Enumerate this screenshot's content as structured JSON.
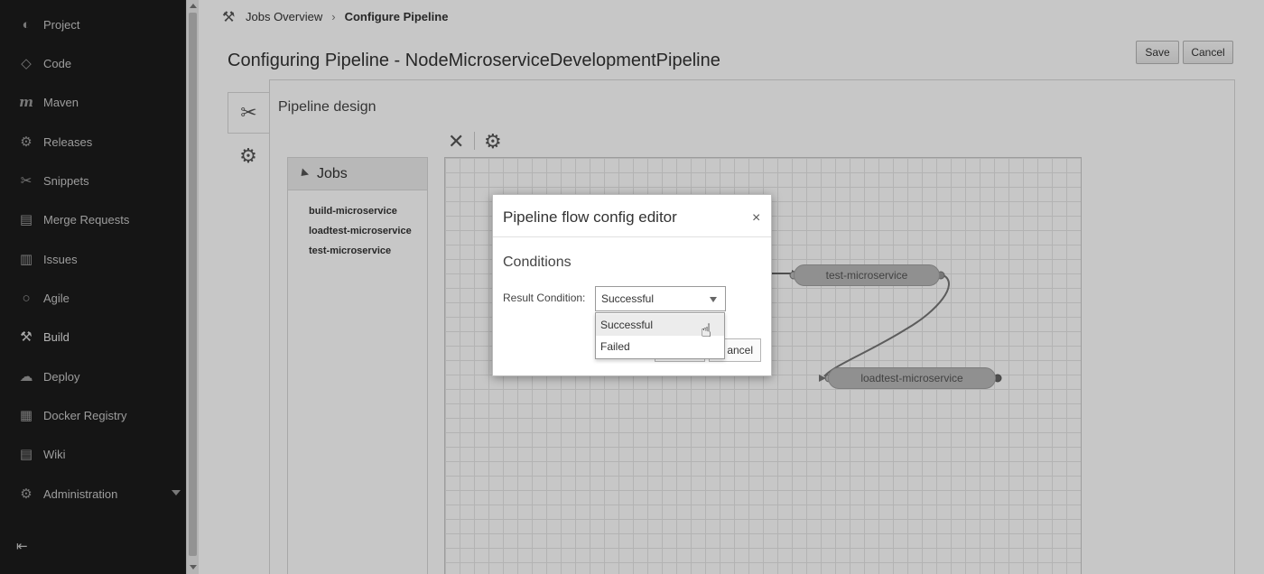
{
  "sidebar": {
    "items": [
      {
        "label": "Project",
        "icon": "globe-icon",
        "glyph": "◐"
      },
      {
        "label": "Code",
        "icon": "code-icon",
        "glyph": "◇"
      },
      {
        "label": "Maven",
        "icon": "maven-icon",
        "glyph": "m"
      },
      {
        "label": "Releases",
        "icon": "gear-icon",
        "glyph": "⚙"
      },
      {
        "label": "Snippets",
        "icon": "scissors-icon",
        "glyph": "✂"
      },
      {
        "label": "Merge Requests",
        "icon": "merge-icon",
        "glyph": "▤"
      },
      {
        "label": "Issues",
        "icon": "issues-icon",
        "glyph": "▥"
      },
      {
        "label": "Agile",
        "icon": "agile-icon",
        "glyph": "○"
      },
      {
        "label": "Build",
        "icon": "hammer-icon",
        "glyph": "⚒"
      },
      {
        "label": "Deploy",
        "icon": "cloud-icon",
        "glyph": "☁"
      },
      {
        "label": "Docker Registry",
        "icon": "docker-icon",
        "glyph": "▦"
      },
      {
        "label": "Wiki",
        "icon": "wiki-icon",
        "glyph": "▤"
      },
      {
        "label": "Administration",
        "icon": "admin-gear-icon",
        "glyph": "⚙"
      }
    ],
    "logout_glyph": "⇤"
  },
  "breadcrumb": {
    "parent": "Jobs Overview",
    "separator": "›",
    "current": "Configure Pipeline"
  },
  "page": {
    "title": "Configuring Pipeline - NodeMicroserviceDevelopmentPipeline",
    "save_label": "Save",
    "cancel_label": "Cancel",
    "design_title": "Pipeline design"
  },
  "toolbar": {
    "delete_glyph": "✕",
    "settings_glyph": "⚙"
  },
  "jobs": {
    "title": "Jobs",
    "items": [
      "build-microservice",
      "loadtest-microservice",
      "test-microservice"
    ]
  },
  "canvas": {
    "nodes": {
      "test": "test-microservice",
      "loadtest": "loadtest-microservice"
    }
  },
  "dialog": {
    "title": "Pipeline flow config editor",
    "close_glyph": "×",
    "section": "Conditions",
    "field_label": "Result Condition:",
    "selected_value": "Successful",
    "options": [
      "Successful",
      "Failed"
    ],
    "cancel_label": "ancel"
  },
  "colors": {
    "sidebar_bg": "#1b1b1b",
    "node_fill": "#b9b9b9",
    "overlay": "rgba(0,0,0,0.22)"
  }
}
